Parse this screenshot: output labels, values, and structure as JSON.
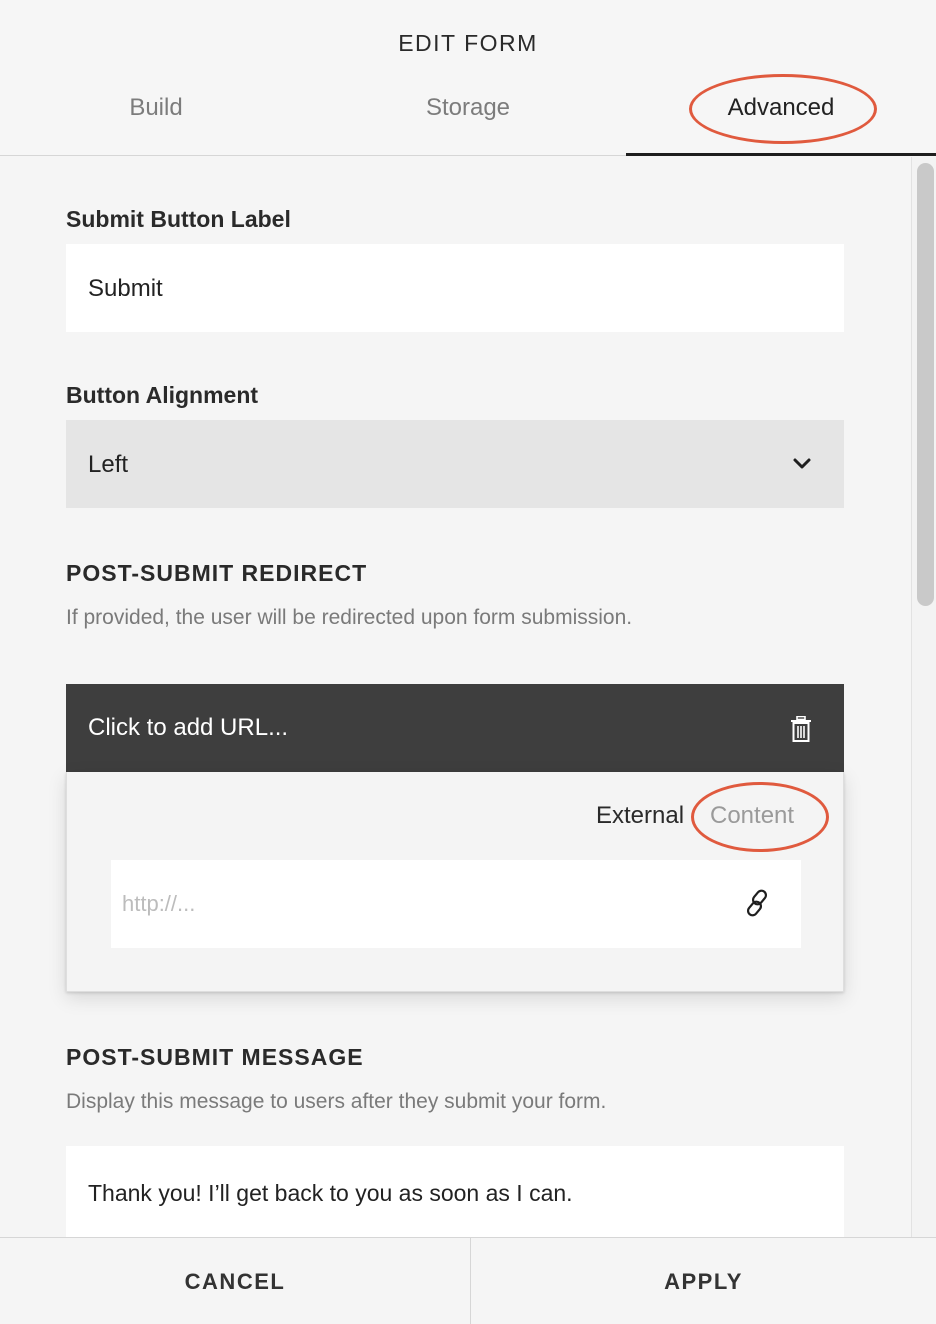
{
  "header": {
    "title": "EDIT FORM",
    "tabs": [
      {
        "label": "Build",
        "active": false
      },
      {
        "label": "Storage",
        "active": false
      },
      {
        "label": "Advanced",
        "active": true
      }
    ]
  },
  "submit_button": {
    "label": "Submit Button Label",
    "value": "Submit"
  },
  "button_alignment": {
    "label": "Button Alignment",
    "selected": "Left"
  },
  "redirect": {
    "heading": "POST-SUBMIT REDIRECT",
    "description": "If provided, the user will be redirected upon form submission.",
    "url_bar_text": "Click to add URL...",
    "toggle": {
      "external": "External",
      "content": "Content"
    },
    "url_placeholder": "http://..."
  },
  "message": {
    "heading": "POST-SUBMIT MESSAGE",
    "description": "Display this message to users after they submit your form.",
    "value": "Thank you! I’ll get back to you as soon as I can."
  },
  "footer": {
    "cancel_label": "CANCEL",
    "apply_label": "APPLY"
  },
  "colors": {
    "annotation": "#e05a3e",
    "url_bar_bg": "#3e3e3e",
    "select_bg": "#e5e5e5"
  },
  "icons": [
    "chevron-down-icon",
    "trash-icon",
    "link-icon"
  ]
}
